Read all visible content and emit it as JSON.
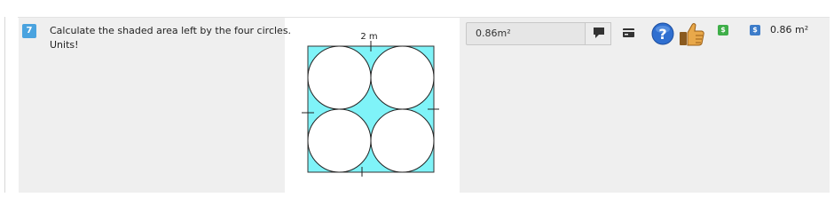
{
  "question": {
    "number": "7",
    "text": "Calculate the shaded area left by the four circles.",
    "units_note": "Units!"
  },
  "figure": {
    "dimension_label": "2 m",
    "shape_fill": "#7ff3f8",
    "circle_count": 4
  },
  "answer": {
    "value": "0.86m²"
  },
  "tools": {
    "comment_icon": "comment-icon",
    "card_icon": "card-icon",
    "help_icon": "help-icon",
    "thumb_icon": "thumbs-up-icon"
  },
  "badges": {
    "green": "$",
    "blue": "$"
  },
  "result": {
    "value": "0.86 m²"
  },
  "colors": {
    "accent_blue": "#4aa3df",
    "green_badge": "#3fae49",
    "blue_badge": "#3d7cc9",
    "help_blue": "#2f6fd0"
  }
}
